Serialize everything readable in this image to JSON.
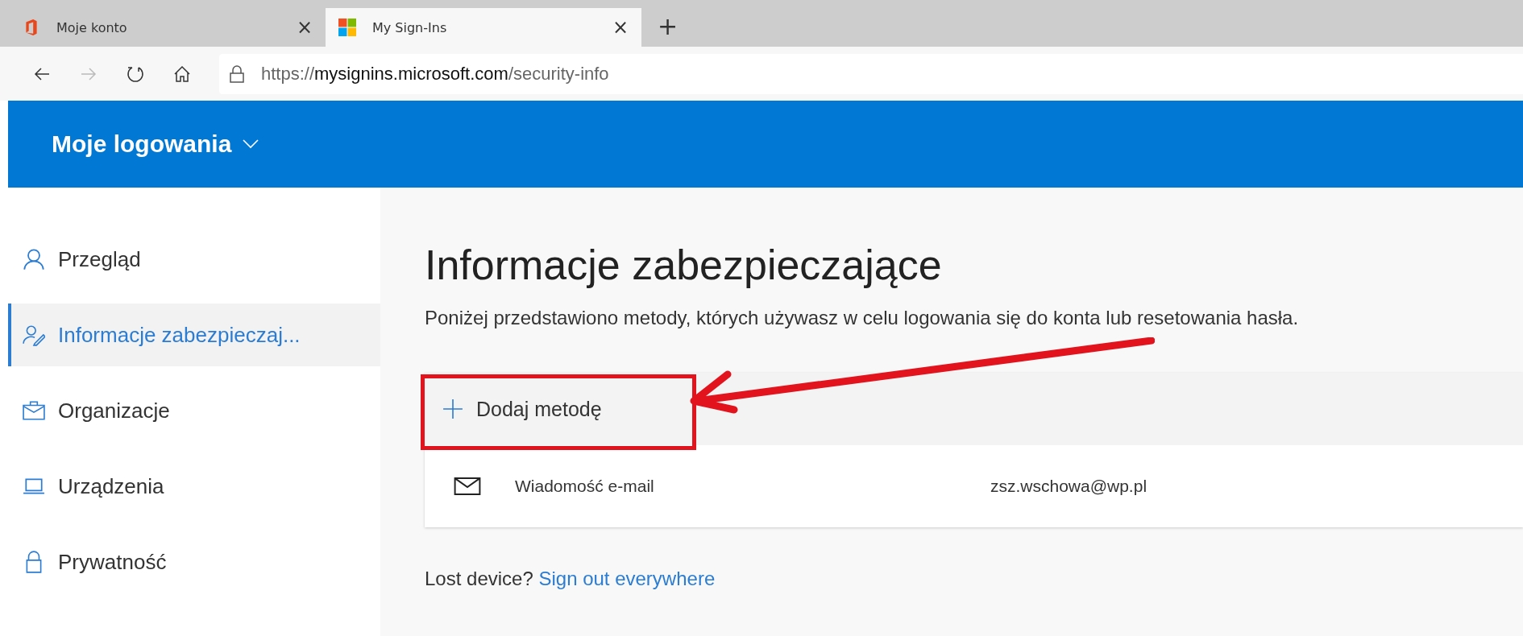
{
  "browser": {
    "tabs": [
      {
        "title": "Moje konto",
        "selected": false,
        "close": "×"
      },
      {
        "title": "My Sign-Ins",
        "selected": true,
        "close": "×"
      }
    ],
    "new_tab": "+",
    "url": {
      "scheme": "https://",
      "host": "mysignins.microsoft.com",
      "path": "/security-info"
    }
  },
  "header": {
    "title": "Moje logowania"
  },
  "sidebar": {
    "items": [
      {
        "label": "Przegląd",
        "selected": false
      },
      {
        "label": "Informacje zabezpieczaj...",
        "selected": true
      },
      {
        "label": "Organizacje",
        "selected": false
      },
      {
        "label": "Urządzenia",
        "selected": false
      },
      {
        "label": "Prywatność",
        "selected": false
      }
    ]
  },
  "main": {
    "title": "Informacje zabezpieczające",
    "description": "Poniżej przedstawiono metody, których używasz w celu logowania się do konta lub resetowania hasła.",
    "add_method": "Dodaj metodę",
    "methods": [
      {
        "name": "Wiadomość e-mail",
        "value": "zsz.wschowa@wp.pl"
      }
    ],
    "lost_device": "Lost device?",
    "sign_out": "Sign out everywhere"
  }
}
